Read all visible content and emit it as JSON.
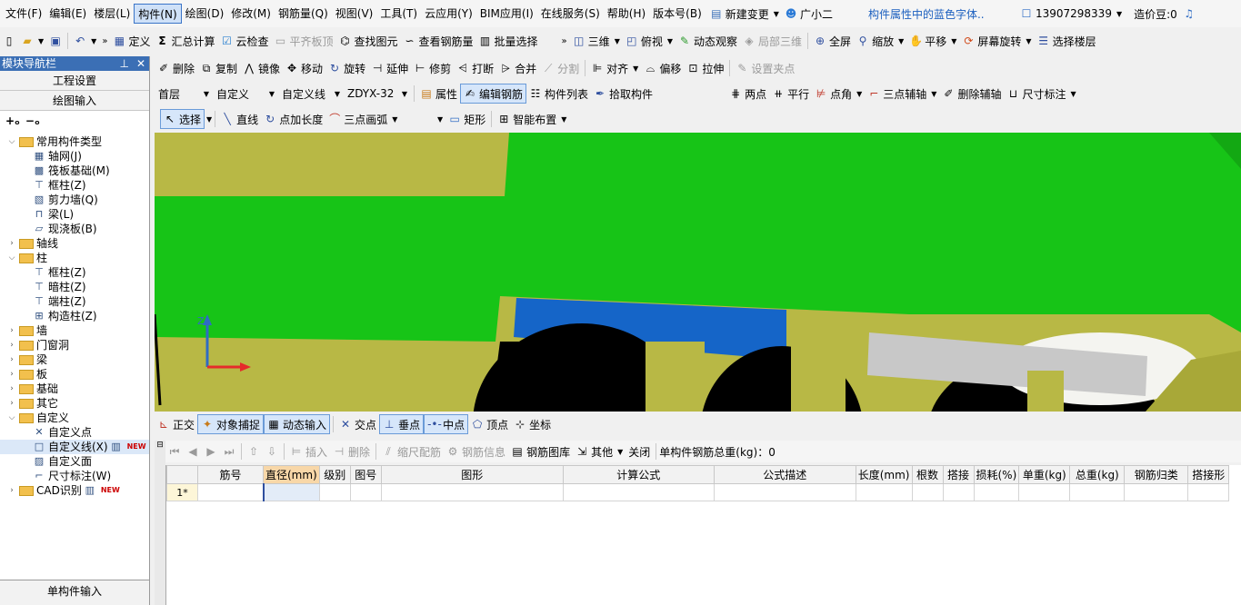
{
  "menubar": {
    "items": [
      "文件(F)",
      "编辑(E)",
      "楼层(L)",
      "构件(N)",
      "绘图(D)",
      "修改(M)",
      "钢筋量(Q)",
      "视图(V)",
      "工具(T)",
      "云应用(Y)",
      "BIM应用(I)",
      "在线服务(S)",
      "帮助(H)",
      "版本号(B)"
    ],
    "active_index": 3,
    "new_change": "新建变更",
    "guangxiaoer": "广小二",
    "tip": "构件属性中的蓝色字体..",
    "phone": "13907298339",
    "price_label": "造价豆:0"
  },
  "toolbar1": {
    "define": "定义",
    "sum": "汇总计算",
    "cloud_check": "云检查",
    "align_slab": "平齐板顶",
    "find": "查找图元",
    "view_rebar": "查看钢筋量",
    "batch_select": "批量选择",
    "view3d": "三维",
    "top_view": "俯视",
    "dyn_view": "动态观察",
    "local3d": "局部三维",
    "fullscreen": "全屏",
    "zoom": "缩放",
    "pan": "平移",
    "rotate_screen": "屏幕旋转",
    "select_floor": "选择楼层"
  },
  "toolbar2": {
    "delete": "删除",
    "copy": "复制",
    "mirror": "镜像",
    "move": "移动",
    "rotate": "旋转",
    "extend": "延伸",
    "trim": "修剪",
    "break": "打断",
    "merge": "合并",
    "split": "分割",
    "align": "对齐",
    "offset": "偏移",
    "stretch": "拉伸",
    "set_grip": "设置夹点"
  },
  "toolbar3": {
    "floor": "首层",
    "type": "自定义",
    "subtype": "自定义线",
    "code": "ZDYX-32",
    "property": "属性",
    "edit_rebar": "编辑钢筋",
    "component_list": "构件列表",
    "pick": "拾取构件",
    "two_point": "两点",
    "parallel": "平行",
    "point_angle": "点角",
    "three_point_aux": "三点辅轴",
    "del_aux": "删除辅轴",
    "dim": "尺寸标注"
  },
  "toolbar4": {
    "select": "选择",
    "line": "直线",
    "point_length": "点加长度",
    "arc3": "三点画弧",
    "rect": "矩形",
    "smart_layout": "智能布置"
  },
  "leftpanel": {
    "title": "模块导航栏",
    "engineering": "工程设置",
    "drawing_input": "绘图输入",
    "single_input": "单构件输入",
    "tree": [
      {
        "level": 0,
        "twist": "⌵",
        "icon": "folder",
        "label": "常用构件类型"
      },
      {
        "level": 1,
        "icon": "grid-icon",
        "label": "轴网(J)"
      },
      {
        "level": 1,
        "icon": "raft-icon",
        "label": "筏板基础(M)"
      },
      {
        "level": 1,
        "icon": "column-icon",
        "label": "框柱(Z)"
      },
      {
        "level": 1,
        "icon": "wall-icon",
        "label": "剪力墙(Q)"
      },
      {
        "level": 1,
        "icon": "beam-icon",
        "label": "梁(L)"
      },
      {
        "level": 1,
        "icon": "slab-icon",
        "label": "现浇板(B)"
      },
      {
        "level": 0,
        "twist": "›",
        "icon": "folder",
        "label": "轴线"
      },
      {
        "level": 0,
        "twist": "⌵",
        "icon": "folder",
        "label": "柱"
      },
      {
        "level": 1,
        "icon": "column-icon",
        "label": "框柱(Z)"
      },
      {
        "level": 1,
        "icon": "column-icon",
        "label": "暗柱(Z)"
      },
      {
        "level": 1,
        "icon": "column-icon",
        "label": "端柱(Z)"
      },
      {
        "level": 1,
        "icon": "struct-col-icon",
        "label": "构造柱(Z)"
      },
      {
        "level": 0,
        "twist": "›",
        "icon": "folder",
        "label": "墙"
      },
      {
        "level": 0,
        "twist": "›",
        "icon": "folder",
        "label": "门窗洞"
      },
      {
        "level": 0,
        "twist": "›",
        "icon": "folder",
        "label": "梁"
      },
      {
        "level": 0,
        "twist": "›",
        "icon": "folder",
        "label": "板"
      },
      {
        "level": 0,
        "twist": "›",
        "icon": "folder",
        "label": "基础"
      },
      {
        "level": 0,
        "twist": "›",
        "icon": "folder",
        "label": "其它"
      },
      {
        "level": 0,
        "twist": "⌵",
        "icon": "folder",
        "label": "自定义"
      },
      {
        "level": 1,
        "icon": "cross-icon",
        "label": "自定义点"
      },
      {
        "level": 1,
        "icon": "line-icon",
        "label": "自定义线(X)",
        "new": "NEW"
      },
      {
        "level": 1,
        "icon": "hatch-icon",
        "label": "自定义面"
      },
      {
        "level": 1,
        "icon": "dim-icon",
        "label": "尺寸标注(W)"
      },
      {
        "level": 0,
        "twist": "›",
        "icon": "folder",
        "label": "CAD识别",
        "new": "NEW"
      }
    ]
  },
  "snapbar": {
    "ortho": "正交",
    "object_snap": "对象捕捉",
    "dynamic_input": "动态输入",
    "intersection": "交点",
    "perpendicular": "垂点",
    "midpoint": "中点",
    "vertex": "顶点",
    "coord": "坐标"
  },
  "gridtoolbar": {
    "insert": "插入",
    "delete": "删除",
    "scale": "缩尺配筋",
    "info": "钢筋信息",
    "library": "钢筋图库",
    "other": "其他",
    "close": "关闭",
    "total": "单构件钢筋总重(kg)：0"
  },
  "grid": {
    "headers": [
      "",
      "筋号",
      "直径(mm)",
      "级别",
      "图号",
      "图形",
      "计算公式",
      "公式描述",
      "长度(mm)",
      "根数",
      "搭接",
      "损耗(%)",
      "单重(kg)",
      "总重(kg)",
      "钢筋归类",
      "搭接形"
    ],
    "highlight_col": 2,
    "rows": [
      [
        "1*",
        "",
        "",
        "",
        "",
        "",
        "",
        "",
        "",
        "",
        "",
        "",
        "",
        "",
        "",
        ""
      ]
    ]
  },
  "axis": {
    "z": "Z"
  }
}
